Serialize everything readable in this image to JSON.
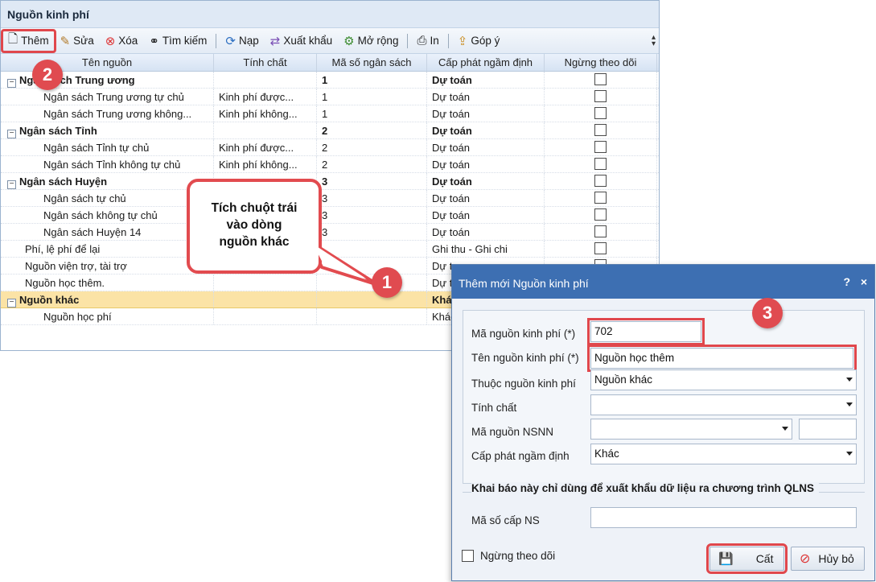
{
  "main": {
    "title": "Nguồn kinh phí",
    "toolbar": {
      "add": "Thêm",
      "edit": "Sửa",
      "delete": "Xóa",
      "search": "Tìm kiếm",
      "reload": "Nạp",
      "export": "Xuất khẩu",
      "expand": "Mở rộng",
      "print": "In",
      "feedback": "Góp ý"
    },
    "columns": [
      "Tên nguồn",
      "Tính chất",
      "Mã số ngân sách",
      "Cấp phát ngầm định",
      "Ngừng theo dõi"
    ],
    "rows": [
      {
        "name": "Ngân sách Trung ương",
        "nature": "",
        "code": "1",
        "alloc": "Dự toán",
        "level": 0,
        "group": true
      },
      {
        "name": "Ngân sách Trung ương tự chủ",
        "nature": "Kinh phí được...",
        "code": "1",
        "alloc": "Dự toán",
        "level": 1
      },
      {
        "name": "Ngân sách Trung ương không...",
        "nature": "Kinh phí không...",
        "code": "1",
        "alloc": "Dự toán",
        "level": 1
      },
      {
        "name": "Ngân sách Tỉnh",
        "nature": "",
        "code": "2",
        "alloc": "Dự toán",
        "level": 0,
        "group": true
      },
      {
        "name": "Ngân sách Tỉnh tự chủ",
        "nature": "Kinh phí được...",
        "code": "2",
        "alloc": "Dự toán",
        "level": 1
      },
      {
        "name": "Ngân sách Tỉnh không tự chủ",
        "nature": "Kinh phí không...",
        "code": "2",
        "alloc": "Dự toán",
        "level": 1
      },
      {
        "name": "Ngân sách Huyện",
        "nature": "",
        "code": "3",
        "alloc": "Dự toán",
        "level": 0,
        "group": true
      },
      {
        "name": "Ngân sách tự chủ",
        "nature": "",
        "code": "3",
        "alloc": "Dự toán",
        "level": 1
      },
      {
        "name": "Ngân sách không tự chủ",
        "nature": "",
        "code": "3",
        "alloc": "Dự toán",
        "level": 1
      },
      {
        "name": "Ngân sách Huyện 14",
        "nature": "",
        "code": "3",
        "alloc": "Dự toán",
        "level": 1
      },
      {
        "name": "Phí, lệ phí để lại",
        "nature": "",
        "code": "",
        "alloc": "Ghi thu - Ghi chi",
        "level": 2
      },
      {
        "name": "Nguồn viện trợ, tài trợ",
        "nature": "",
        "code": "",
        "alloc": "Dự t",
        "level": 2
      },
      {
        "name": "Nguồn học thêm.",
        "nature": "",
        "code": "",
        "alloc": "Dự t",
        "level": 2
      },
      {
        "name": "Nguồn khác",
        "nature": "",
        "code": "",
        "alloc": "Khác",
        "level": 0,
        "group": true,
        "selected": true
      },
      {
        "name": "Nguồn học phí",
        "nature": "",
        "code": "",
        "alloc": "Khác",
        "level": 1
      }
    ]
  },
  "callout": {
    "line1": "Tích chuột trái",
    "line2": "vào dòng",
    "line3": "nguồn khác"
  },
  "steps": {
    "one": "1",
    "two": "2",
    "three": "3"
  },
  "dialog": {
    "title": "Thêm mới Nguồn kinh phí",
    "help": "?",
    "close": "×",
    "fields": {
      "code_label": "Mã nguồn kinh phí (*)",
      "code_value": "702",
      "name_label": "Tên nguồn kinh phí (*)",
      "name_value": "Nguồn học thêm",
      "parent_label": "Thuộc nguồn kinh phí",
      "parent_value": "Nguồn khác",
      "nature_label": "Tính chất",
      "nature_value": "",
      "nsnn_label": "Mã nguồn NSNN",
      "nsnn_value": "",
      "nsnn_extra": "",
      "alloc_label": "Cấp phát ngầm định",
      "alloc_value": "Khác"
    },
    "section_title": "Khai báo này chỉ dùng để xuất khẩu dữ liệu ra chương trình QLNS",
    "budget_code_label": "Mã số cấp NS",
    "budget_code_value": "",
    "stop_label": "Ngừng theo dõi",
    "save": "Cất",
    "cancel": "Hủy bỏ"
  },
  "colors": {
    "accent": "#e0474c",
    "dialog_title": "#3d6fb2",
    "selected_row": "#fbe3a6"
  }
}
